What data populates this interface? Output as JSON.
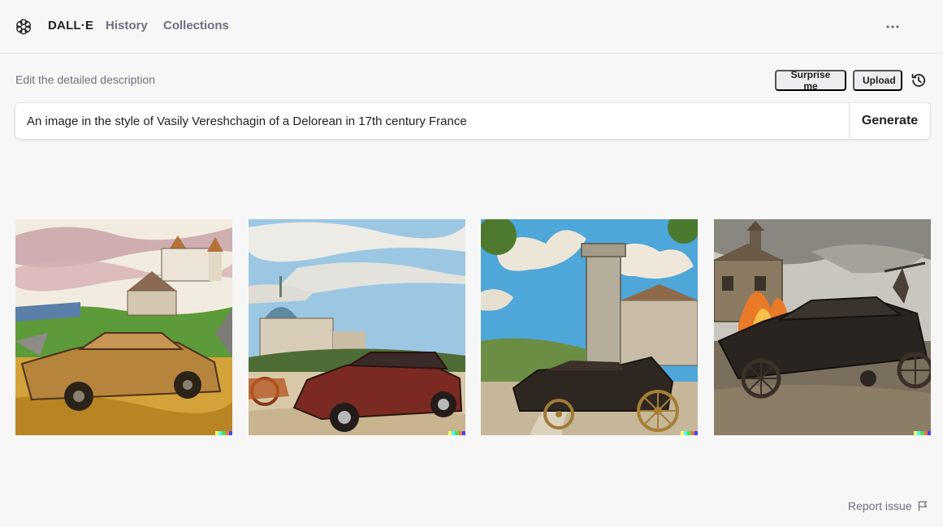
{
  "header": {
    "brand": "DALL·E",
    "nav": [
      {
        "label": "History"
      },
      {
        "label": "Collections"
      }
    ],
    "more_icon": "ellipsis-icon",
    "logo_icon": "openai-logo-icon"
  },
  "prompt": {
    "label": "Edit the detailed description",
    "value": "An image in the style of Vasily Vereshchagin of a Delorean in 17th century France",
    "generate_label": "Generate",
    "surprise_label": "Surprise me",
    "upload_label": "Upload",
    "history_icon": "history-icon"
  },
  "images": [
    {
      "subject": "gold-car-with-castle"
    },
    {
      "subject": "red-car-with-domed-church"
    },
    {
      "subject": "carriage-car-with-tower"
    },
    {
      "subject": "dark-car-with-fire"
    }
  ],
  "signature_colors": [
    "#ffff66",
    "#42ffff",
    "#51da4c",
    "#ff6e3c",
    "#3c46ff"
  ],
  "footer": {
    "report_label": "Report issue",
    "flag_icon": "flag-icon"
  },
  "colors": {
    "background": "#f7f7f8",
    "text_primary": "#202123",
    "text_secondary": "#6e6e80",
    "chip_bg": "#ececf1"
  }
}
